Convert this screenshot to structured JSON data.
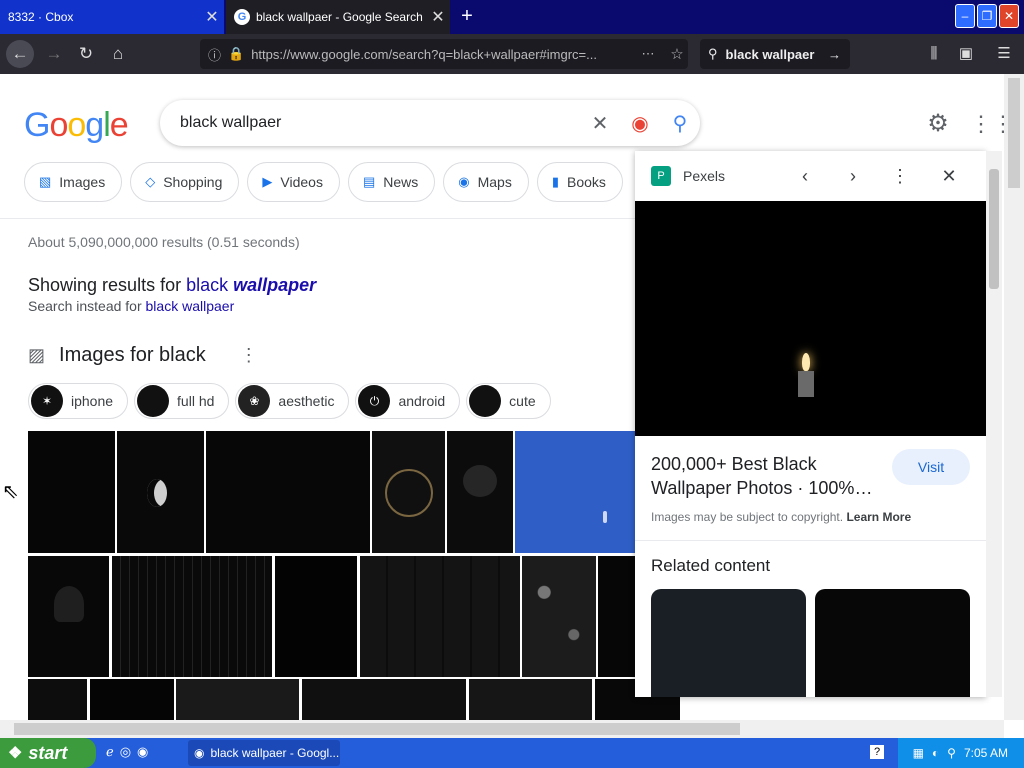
{
  "tabs": [
    {
      "label": "8332 · Cbox"
    },
    {
      "label": "black wallpaer - Google Search"
    }
  ],
  "nav": {
    "url": "https://www.google.com/search?q=black+wallpaer#imgrc=...",
    "search_text": "black wallpaer"
  },
  "google": {
    "logo": "Google",
    "query": "black wallpaer",
    "filters": [
      "Images",
      "Shopping",
      "Videos",
      "News",
      "Maps",
      "Books"
    ],
    "stats": "About 5,090,000,000 results (0.51 seconds)",
    "showing_prefix": "Showing results for",
    "showing_black": "black",
    "showing_corrected": "wallpaper",
    "instead_prefix": "Search instead for",
    "instead_link": "black wallpaer",
    "images_heading": "Images for black",
    "suggestions": [
      "iphone",
      "full hd",
      "aesthetic",
      "android",
      "cute"
    ]
  },
  "panel": {
    "source": "Pexels",
    "title": "200,000+ Best Black Wallpaper Photos · 100%…",
    "visit": "Visit",
    "copyright": "Images may be subject to copyright.",
    "learn_more": "Learn More",
    "related": "Related content"
  },
  "taskbar": {
    "start": "start",
    "task": "black wallpaer - Googl...",
    "time": "7:05 AM"
  },
  "colors": {
    "tab_active": "#1e1e24",
    "link": "#1a0dab",
    "accent": "#1a73e8",
    "taskbar": "#245edb"
  }
}
